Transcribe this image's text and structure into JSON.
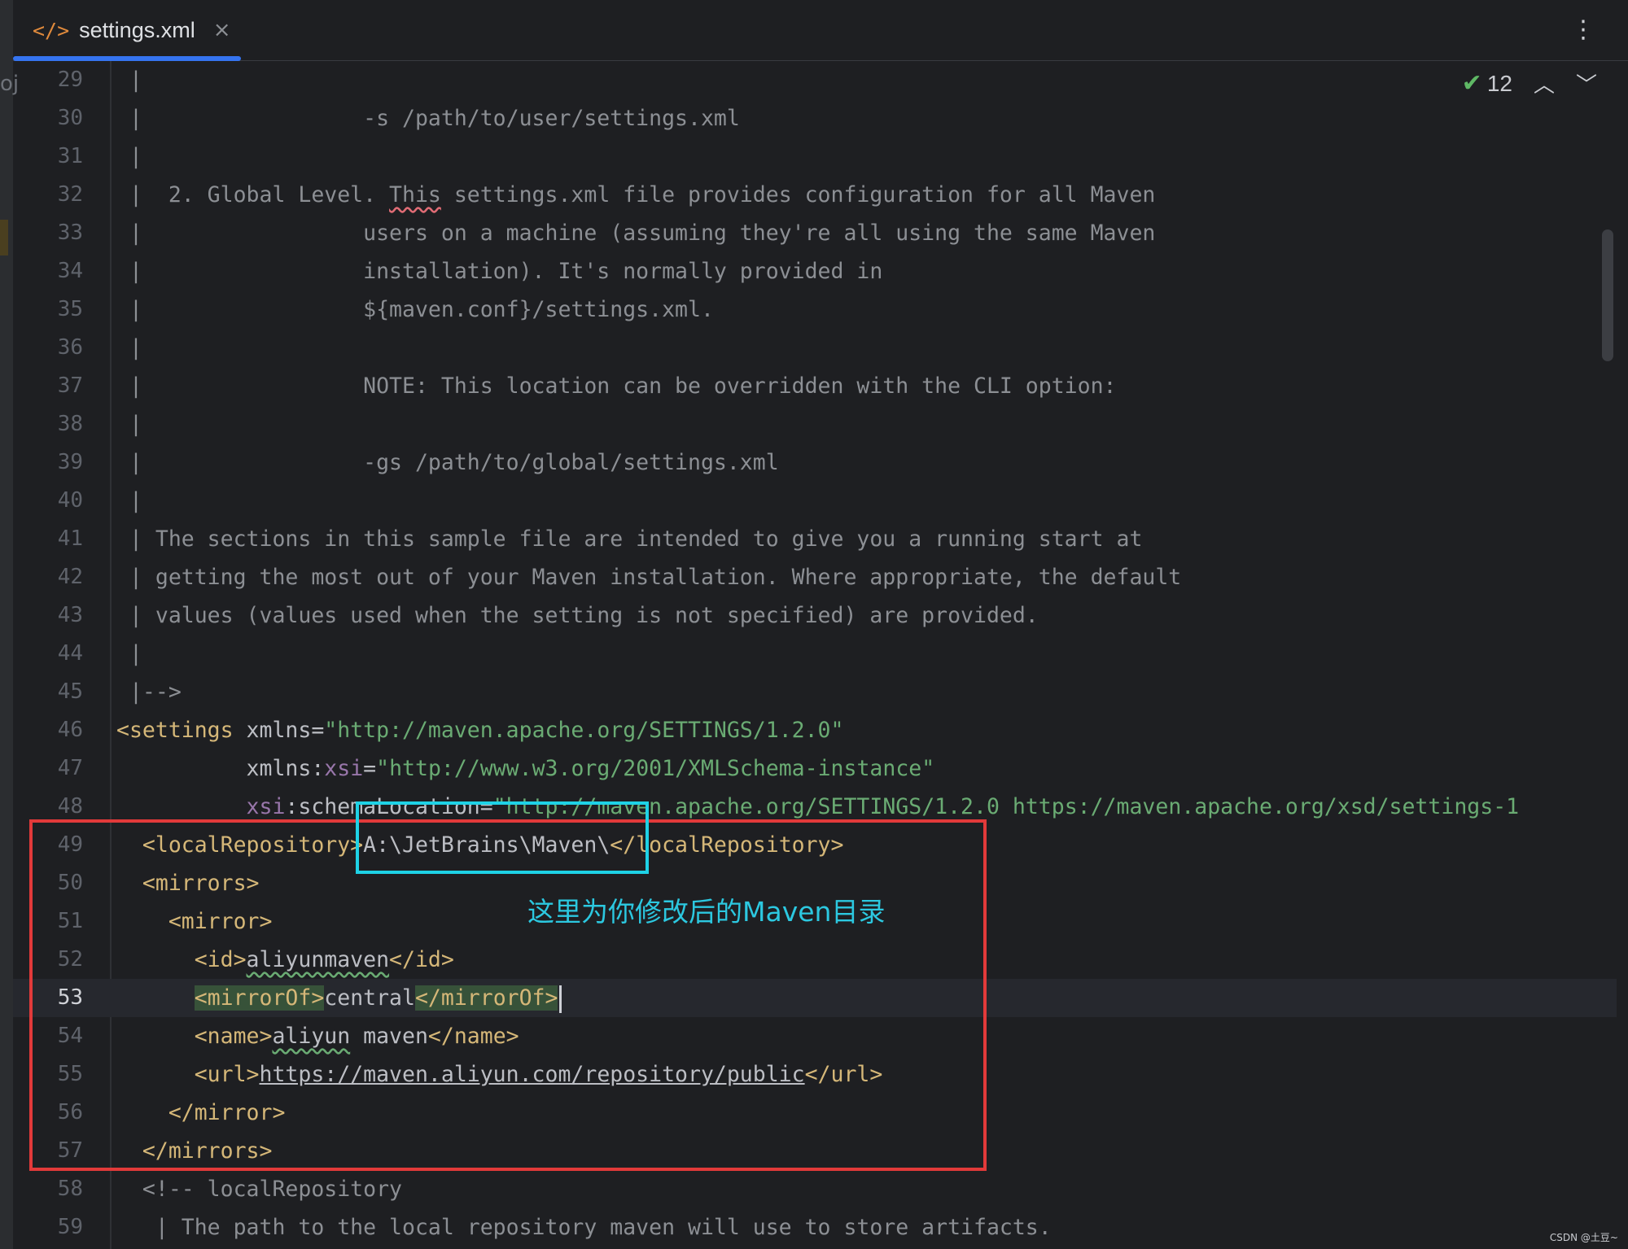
{
  "tab": {
    "icon": "</>",
    "label": "settings.xml",
    "close_label": "×"
  },
  "toolbar": {
    "more_label": "⋮"
  },
  "inspection": {
    "check_label": "✔",
    "count": "12",
    "up_label": "︿",
    "down_label": "﹀"
  },
  "left_fragment": "oj",
  "annotation": "这里为你修改后的Maven目录",
  "watermark": "CSDN @土豆~",
  "editor": {
    "current_line": 53,
    "lines": [
      {
        "n": 29,
        "segs": [
          {
            "t": " |",
            "c": "comment"
          }
        ]
      },
      {
        "n": 30,
        "segs": [
          {
            "t": " |                 -s /path/to/user/settings.xml",
            "c": "comment"
          }
        ]
      },
      {
        "n": 31,
        "segs": [
          {
            "t": " |",
            "c": "comment"
          }
        ]
      },
      {
        "n": 32,
        "segs": [
          {
            "t": " |  2. Global Level. ",
            "c": "comment"
          },
          {
            "t": "This",
            "c": "comment squig-red"
          },
          {
            "t": " settings.xml file provides configuration for all Maven",
            "c": "comment"
          }
        ]
      },
      {
        "n": 33,
        "segs": [
          {
            "t": " |                 users on a machine (assuming they're all using the same Maven",
            "c": "comment"
          }
        ]
      },
      {
        "n": 34,
        "segs": [
          {
            "t": " |                 installation). It's normally provided in",
            "c": "comment"
          }
        ]
      },
      {
        "n": 35,
        "segs": [
          {
            "t": " |                 ${maven.conf}/settings.xml.",
            "c": "comment"
          }
        ]
      },
      {
        "n": 36,
        "segs": [
          {
            "t": " |",
            "c": "comment"
          }
        ]
      },
      {
        "n": 37,
        "segs": [
          {
            "t": " |                 NOTE: This location can be overridden with the CLI option:",
            "c": "comment"
          }
        ]
      },
      {
        "n": 38,
        "segs": [
          {
            "t": " |",
            "c": "comment"
          }
        ]
      },
      {
        "n": 39,
        "segs": [
          {
            "t": " |                 -gs /path/to/global/settings.xml",
            "c": "comment"
          }
        ]
      },
      {
        "n": 40,
        "segs": [
          {
            "t": " |",
            "c": "comment"
          }
        ]
      },
      {
        "n": 41,
        "segs": [
          {
            "t": " | The sections in this sample file are intended to give you a running start at",
            "c": "comment"
          }
        ]
      },
      {
        "n": 42,
        "segs": [
          {
            "t": " | getting the most out of your Maven installation. Where appropriate, the default",
            "c": "comment"
          }
        ]
      },
      {
        "n": 43,
        "segs": [
          {
            "t": " | values (values used when the setting is not specified) are provided.",
            "c": "comment"
          }
        ]
      },
      {
        "n": 44,
        "segs": [
          {
            "t": " |",
            "c": "comment"
          }
        ]
      },
      {
        "n": 45,
        "segs": [
          {
            "t": " |-->",
            "c": "comment"
          }
        ]
      },
      {
        "n": 46,
        "segs": [
          {
            "t": "<settings",
            "c": "tag"
          },
          {
            "t": " xmlns",
            "c": "attr"
          },
          {
            "t": "=",
            "c": "txt"
          },
          {
            "t": "\"http://maven.apache.org/SETTINGS/1.2.0\"",
            "c": "str"
          }
        ]
      },
      {
        "n": 47,
        "segs": [
          {
            "t": "          xmlns",
            "c": "attr"
          },
          {
            "t": ":",
            "c": "txt"
          },
          {
            "t": "xsi",
            "c": "ns"
          },
          {
            "t": "=",
            "c": "txt"
          },
          {
            "t": "\"http://www.w3.org/2001/XMLSchema-instance\"",
            "c": "str"
          }
        ]
      },
      {
        "n": 48,
        "segs": [
          {
            "t": "          ",
            "c": "txt"
          },
          {
            "t": "xsi",
            "c": "ns"
          },
          {
            "t": ":schemaLocation=",
            "c": "attr"
          },
          {
            "t": "\"http://maven.apache.org/SETTINGS/1.2.0 https://maven.apache.org/xsd/settings-1",
            "c": "str"
          }
        ]
      },
      {
        "n": 49,
        "segs": [
          {
            "t": "  <localRepository>",
            "c": "tag"
          },
          {
            "t": "A:\\JetBrains\\Maven\\",
            "c": "txt"
          },
          {
            "t": "</localRepository>",
            "c": "tag"
          }
        ]
      },
      {
        "n": 50,
        "segs": [
          {
            "t": "  <mirrors>",
            "c": "tag"
          }
        ]
      },
      {
        "n": 51,
        "segs": [
          {
            "t": "    <mirror>",
            "c": "tag"
          }
        ]
      },
      {
        "n": 52,
        "segs": [
          {
            "t": "      <id>",
            "c": "tag"
          },
          {
            "t": "aliyunmaven",
            "c": "txt squig"
          },
          {
            "t": "</id>",
            "c": "tag"
          }
        ]
      },
      {
        "n": 53,
        "segs": [
          {
            "t": "      ",
            "c": "txt"
          },
          {
            "t": "<mirrorOf>",
            "c": "tag hl"
          },
          {
            "t": "central",
            "c": "txt"
          },
          {
            "t": "</mirrorOf>",
            "c": "tag hl"
          }
        ],
        "caret": true
      },
      {
        "n": 54,
        "segs": [
          {
            "t": "      <name>",
            "c": "tag"
          },
          {
            "t": "aliyun",
            "c": "txt squig"
          },
          {
            "t": " maven",
            "c": "txt"
          },
          {
            "t": "</name>",
            "c": "tag"
          }
        ]
      },
      {
        "n": 55,
        "segs": [
          {
            "t": "      <url>",
            "c": "tag"
          },
          {
            "t": "https://maven.aliyun.com/repository/public",
            "c": "url"
          },
          {
            "t": "</url>",
            "c": "tag"
          }
        ]
      },
      {
        "n": 56,
        "segs": [
          {
            "t": "    </mirror>",
            "c": "tag"
          }
        ]
      },
      {
        "n": 57,
        "segs": [
          {
            "t": "  </mirrors>",
            "c": "tag"
          }
        ]
      },
      {
        "n": 58,
        "segs": [
          {
            "t": "  <!-- localRepository",
            "c": "comment"
          }
        ]
      },
      {
        "n": 59,
        "segs": [
          {
            "t": "   | The path to the local repository maven will use to store artifacts.",
            "c": "comment"
          }
        ]
      }
    ]
  }
}
